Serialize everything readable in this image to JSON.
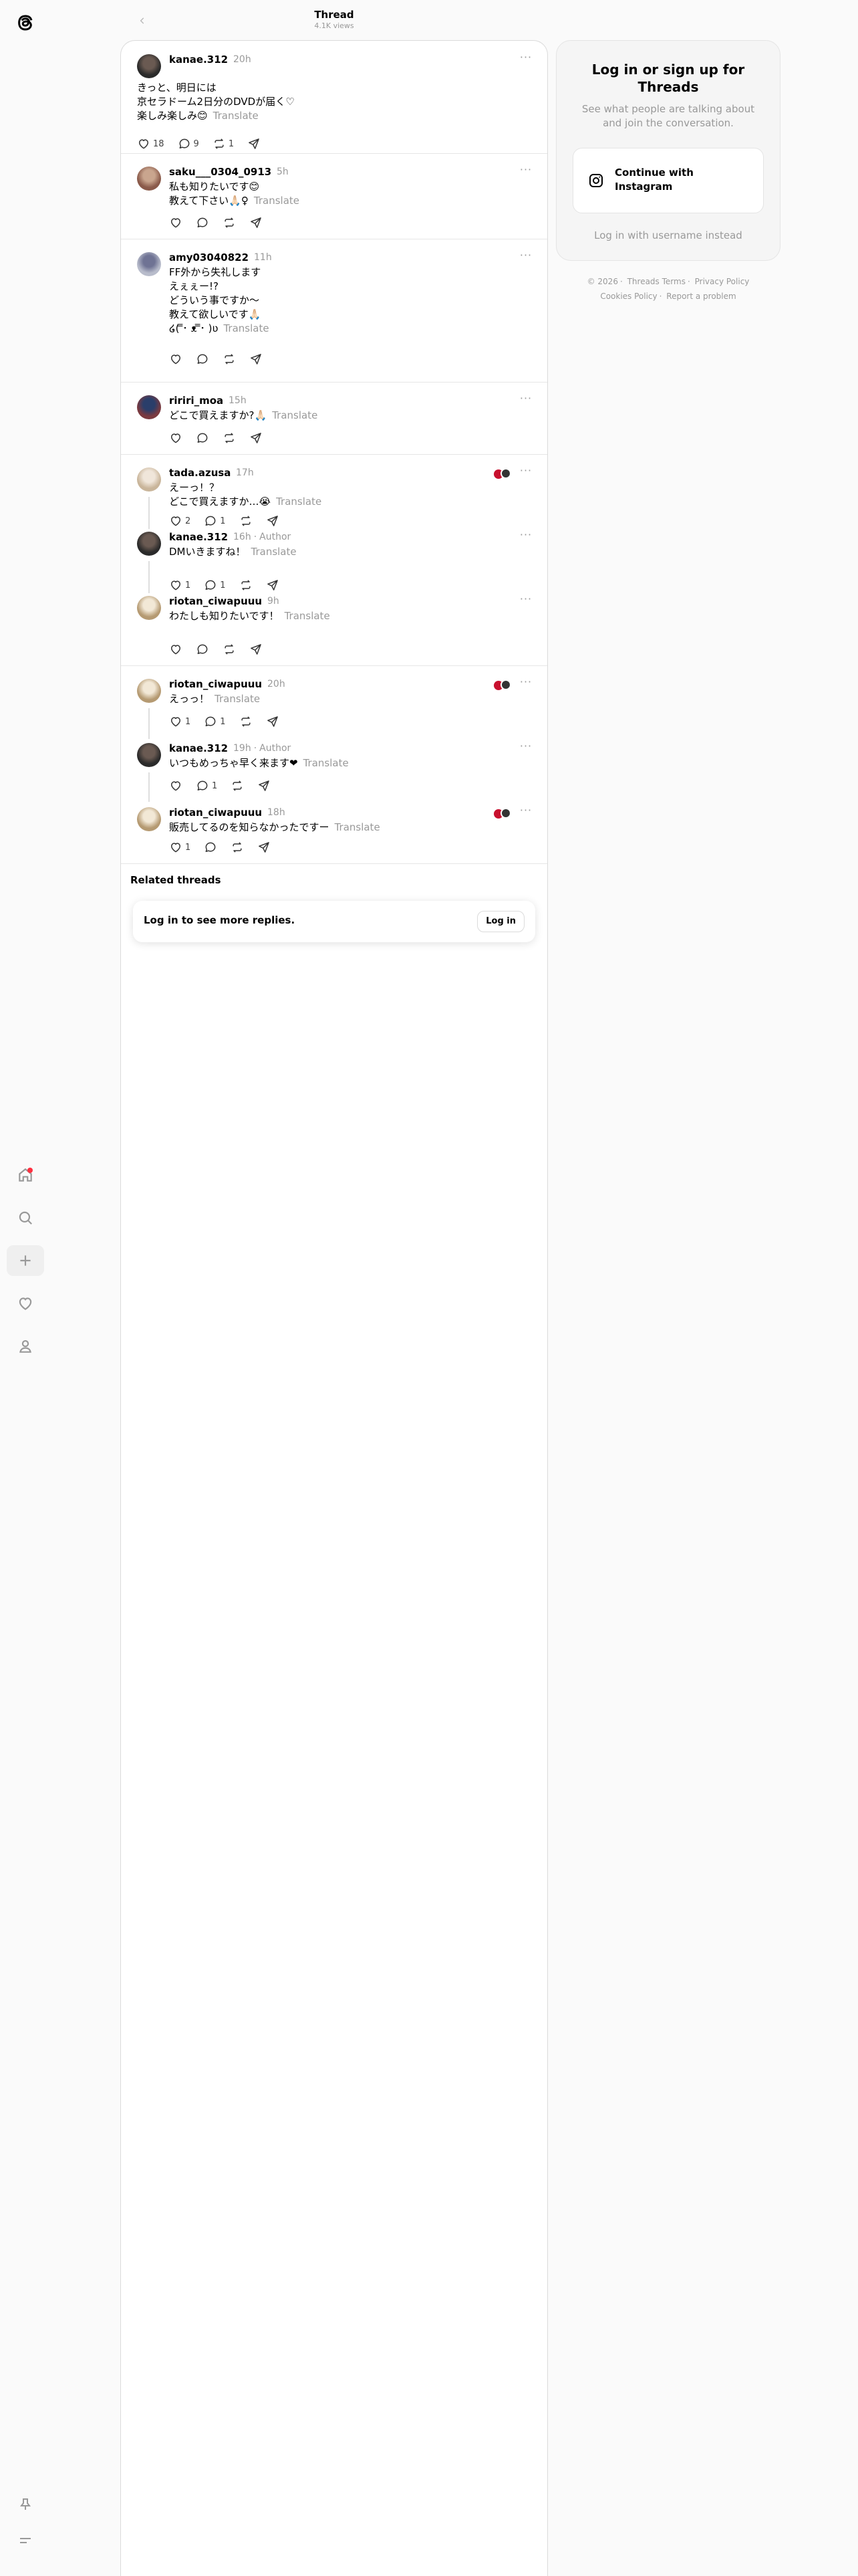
{
  "header": {
    "title": "Thread",
    "subtitle": "4.1K views"
  },
  "thread": [
    {
      "username": "kanae.312",
      "time": "20h",
      "text": "きっと、明日には\n京セラドーム2日分のDVDが届く♡\n楽しみ楽しみ😊",
      "likes": "18",
      "replies": "9",
      "reposts": "1"
    },
    {
      "username": "saku___0304_0913",
      "time": "5h",
      "text": "私も知りたいです😊\n教えて下さい🙏🏻♀",
      "likes": "",
      "replies": "",
      "reposts": ""
    },
    {
      "username": "amy03040822",
      "time": "11h",
      "text": "FF外から失礼します\nえぇぇー!?\nどういう事ですか〜\n教えて欲しいです🙏🏻\n໒( ̿･ ᴥ ̿･ )ʋ",
      "likes": "",
      "replies": "",
      "reposts": ""
    },
    {
      "username": "ririri_moa",
      "time": "15h",
      "text": "どこで買えますか?🙏🏻",
      "likes": "",
      "replies": "",
      "reposts": ""
    },
    {
      "username": "tada.azusa",
      "time": "17h",
      "text": "えーっ！？\nどこで買えますか…😭",
      "likes": "2",
      "replies": "1",
      "reposts": ""
    },
    {
      "username": "kanae.312",
      "time": "16h",
      "author": "Author",
      "text": "DMいきますね！",
      "likes": "1",
      "replies": "1",
      "reposts": ""
    },
    {
      "username": "riotan_ciwapuuu",
      "time": "9h",
      "text": "わたしも知りたいです！",
      "likes": "",
      "replies": "",
      "reposts": ""
    },
    {
      "username": "riotan_ciwapuuu",
      "time": "20h",
      "text": "えっっ！",
      "likes": "1",
      "replies": "1",
      "reposts": ""
    },
    {
      "username": "kanae.312",
      "time": "19h",
      "author": "Author",
      "text": "いつもめっちゃ早く来ます❤",
      "likes": "",
      "replies": "1",
      "reposts": ""
    },
    {
      "username": "riotan_ciwapuuu",
      "time": "18h",
      "text": "販売してるのを知らなかったですー",
      "likes": "1",
      "replies": "",
      "reposts": ""
    }
  ],
  "translate_label": "Translate",
  "author_sep": "·",
  "related": {
    "title": "Related threads",
    "login_prompt": "Log in to see more replies.",
    "login_button": "Log in"
  },
  "login_card": {
    "title": "Log in or sign up for Threads",
    "subtitle": "See what people are talking about and join the conversation.",
    "instagram_button": "Continue with Instagram",
    "alt_login": "Log in with username instead"
  },
  "footer": {
    "copyright": "© 2026",
    "links1": [
      "Threads Terms",
      "Privacy Policy"
    ],
    "links2": [
      "Cookies Policy",
      "Report a problem"
    ]
  },
  "icons": {
    "logo": "threads-logo-icon",
    "home": "home-icon",
    "search": "search-icon",
    "create": "plus-icon",
    "activity": "heart-icon",
    "profile": "person-icon",
    "pin": "pin-icon",
    "menu": "menu-icon",
    "back": "arrow-left-icon",
    "like": "heart-icon",
    "reply": "comment-icon",
    "repost": "repost-icon",
    "share": "send-icon",
    "more": "more-icon",
    "instagram": "instagram-icon"
  },
  "colors": {
    "notification": "#ff3040",
    "muted": "#999999",
    "text": "#000000"
  }
}
